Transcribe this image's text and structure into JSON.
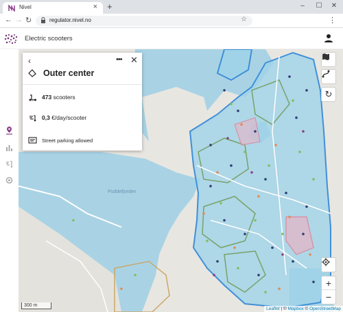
{
  "browser": {
    "tab_title": "Nivel",
    "tab_close": "×",
    "new_tab": "+",
    "url": "regulator.nivel.no",
    "window_controls": [
      "–",
      "☐",
      "✕"
    ]
  },
  "header": {
    "title": "Electric scooters"
  },
  "sidebar": {
    "items": [
      "map-pin-icon",
      "bar-chart-icon",
      "scooter-icon",
      "settings-icon"
    ],
    "active_color": "#8a3f88"
  },
  "panel": {
    "title": "Outer center",
    "scooters_count": "473",
    "scooters_label": "scooters",
    "fee_value": "0,3",
    "fee_unit": "€/day/scooter",
    "parking_rule": "Street parking allowed"
  },
  "map_controls": {
    "layers_icon": "map-icon",
    "routes_icon": "route-icon",
    "refresh_icon": "refresh-icon",
    "locate_icon": "locate-icon",
    "zoom_in": "+",
    "zoom_out": "−"
  },
  "map": {
    "place_label": "Puddefjorden",
    "scale_label": "300 m",
    "attribution_leaflet": "Leaflet",
    "attribution_sep": " | © ",
    "attribution_mapbox": "Mapbox",
    "attribution_sep2": " © ",
    "attribution_osm": "OpenStreetMap",
    "colors": {
      "water": "#a9d3e5",
      "land": "#e8e6e1",
      "zone_fill": "#9fd3e8",
      "zone_border": "#3f8fd8",
      "sub_zone": "#76a26a",
      "restricted": "#d98aa0"
    }
  }
}
